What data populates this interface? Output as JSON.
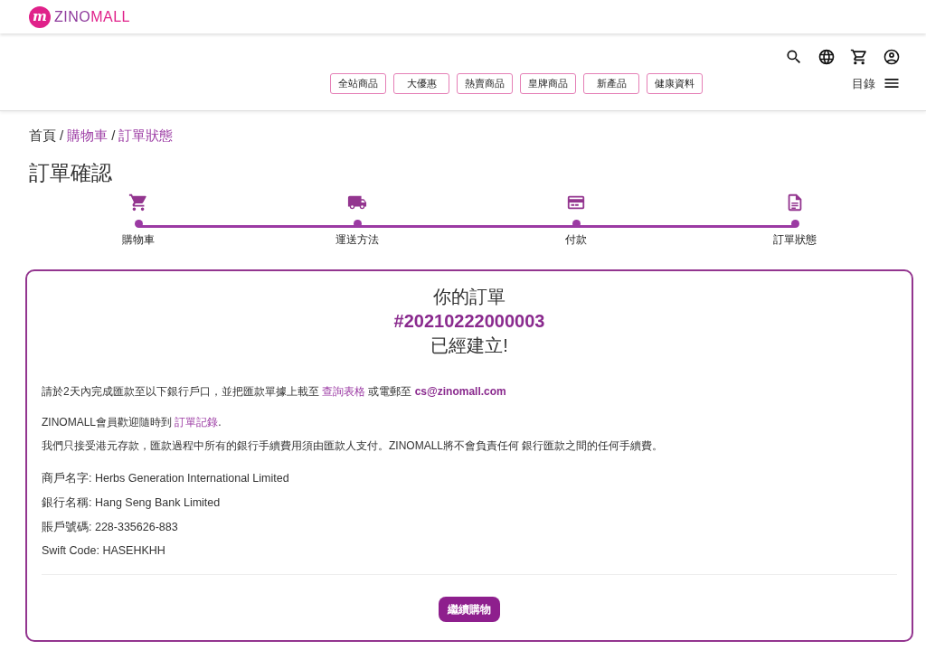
{
  "logo": {
    "mark": "m",
    "brand_1": "ZINO",
    "brand_2": "MALL"
  },
  "nav": [
    "全站商品",
    "大優惠",
    "熱賣商品",
    "皇牌商品",
    "新產品",
    "健康資料"
  ],
  "menu_label": "目錄",
  "breadcrumb_separator": "/",
  "breadcrumb": [
    {
      "label": "首頁",
      "kind": "text"
    },
    {
      "label": "購物車",
      "kind": "link"
    },
    {
      "label": "訂單狀態",
      "kind": "link"
    }
  ],
  "page_title": "訂單確認",
  "steps": [
    {
      "kind": "cart",
      "label": "購物車"
    },
    {
      "kind": "truck",
      "label": "運送方法"
    },
    {
      "kind": "card",
      "label": "付款"
    },
    {
      "kind": "doc",
      "label": "訂單狀態"
    }
  ],
  "order": {
    "heading": "你的訂單",
    "number": "#20210222000003",
    "status": "已經建立!"
  },
  "paragraphs": [
    {
      "parts": [
        {
          "kind": "text",
          "text": "請於2天內完成匯款至以下銀行戶口，並把匯款單據上載至 "
        },
        {
          "kind": "link",
          "text": "查詢表格"
        },
        {
          "kind": "text",
          "text": " 或電郵至 "
        },
        {
          "kind": "email",
          "text": "cs@zinomall.com"
        }
      ]
    },
    {
      "parts": [
        {
          "kind": "text",
          "text": "ZINOMALL會員歡迎隨時到 "
        },
        {
          "kind": "link",
          "text": "訂單記錄"
        },
        {
          "kind": "text",
          "text": "."
        }
      ]
    },
    {
      "parts": [
        {
          "kind": "text",
          "text": "我們只接受港元存款，匯款過程中所有的銀行手續費用須由匯款人支付。ZINOMALL將不會負責任何 銀行匯款之間的任何手續費。"
        }
      ]
    }
  ],
  "bank_details": [
    "商戶名字: Herbs Generation International Limited",
    "銀行名稱: Hang Seng Bank Limited",
    "賬戶號碼: 228-335626-883",
    "Swift Code: HASEHKHH"
  ],
  "continue_button": "繼續購物"
}
